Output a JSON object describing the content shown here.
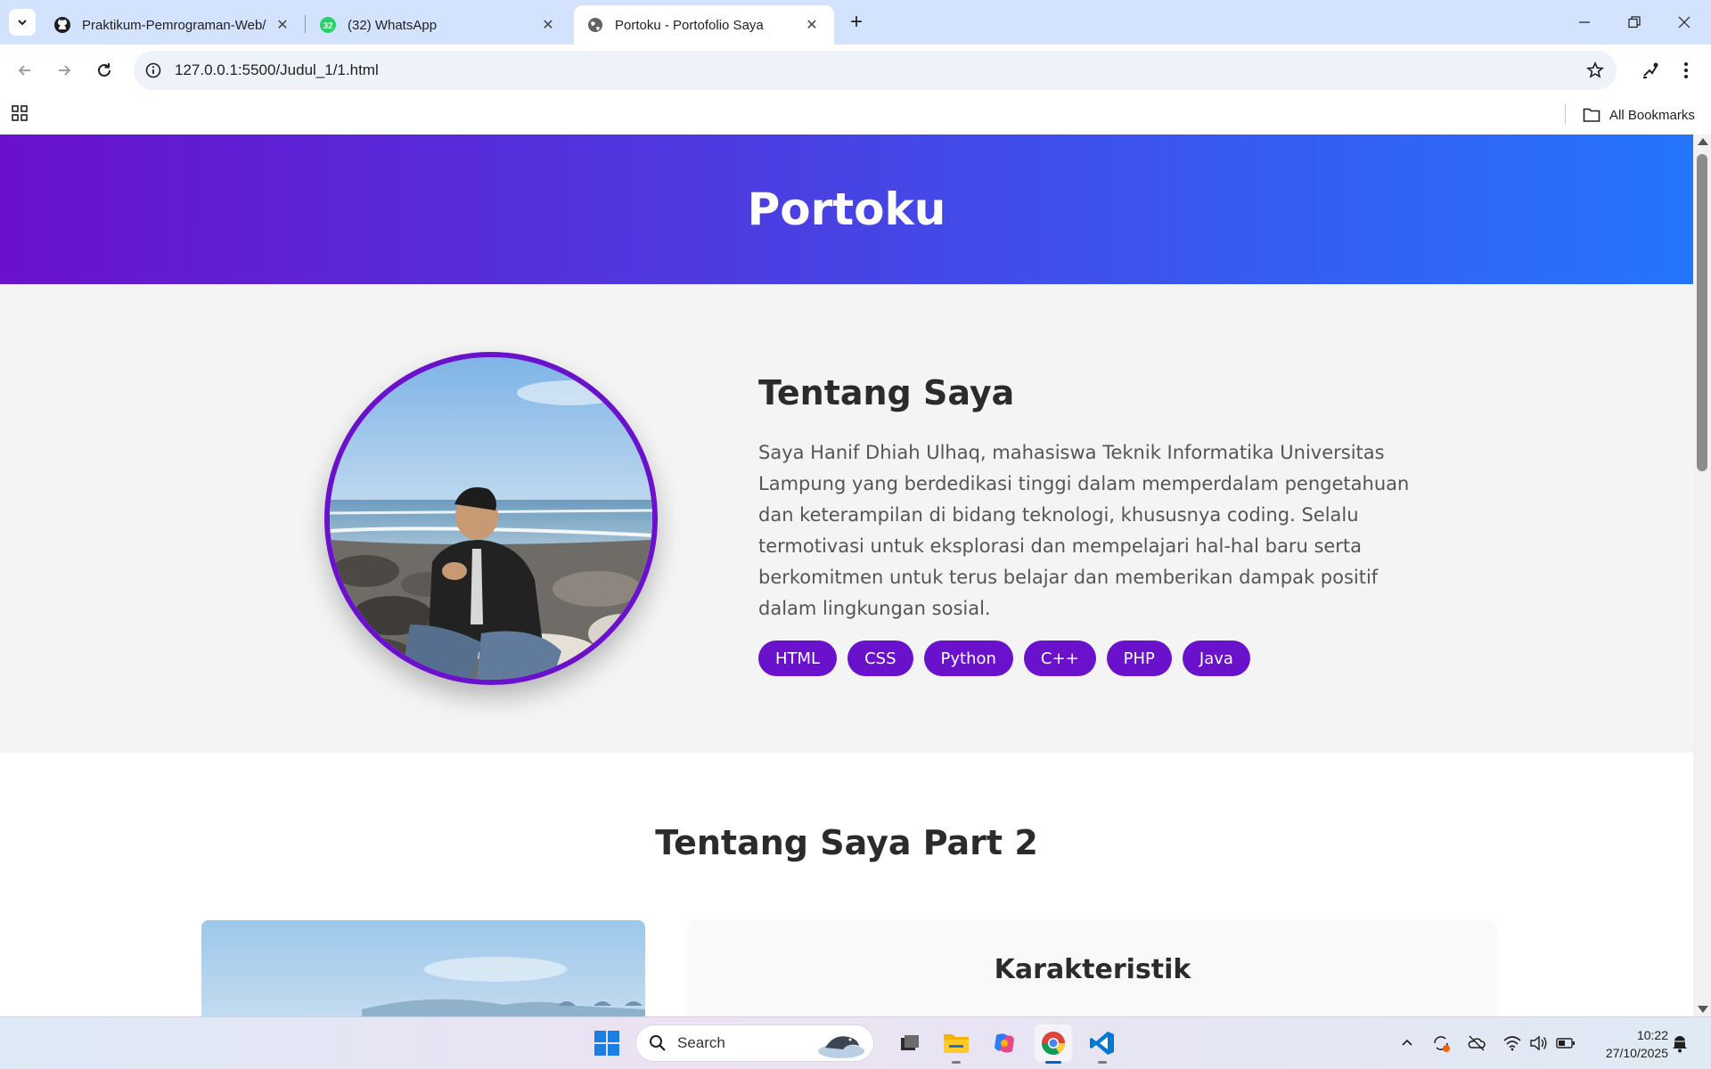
{
  "browser": {
    "tabs": [
      {
        "title": "Praktikum-Pemrograman-Web/",
        "favicon": "github-icon",
        "active": false
      },
      {
        "title": "(32) WhatsApp",
        "favicon": "whatsapp-icon",
        "badge": "32",
        "active": false
      },
      {
        "title": "Portoku - Portofolio Saya",
        "favicon": "globe-icon",
        "active": true
      }
    ],
    "url": "127.0.0.1:5500/Judul_1/1.html",
    "bookmarks_label": "All Bookmarks"
  },
  "page": {
    "header_title": "Portoku",
    "about": {
      "heading": "Tentang Saya",
      "paragraph": "Saya Hanif Dhiah Ulhaq, mahasiswa Teknik Informatika Universitas Lampung yang berdedikasi tinggi dalam memperdalam pengetahuan dan keterampilan di bidang teknologi, khususnya coding. Selalu termotivasi untuk eksplorasi dan mempelajari hal-hal baru serta berkomitmen untuk terus belajar dan memberikan dampak positif dalam lingkungan sosial.",
      "skills": [
        "HTML",
        "CSS",
        "Python",
        "C++",
        "PHP",
        "Java"
      ]
    },
    "part2": {
      "heading": "Tentang Saya Part 2",
      "card_heading": "Karakteristik"
    }
  },
  "taskbar": {
    "search_label": "Search",
    "time": "10:22",
    "date": "27/10/2025"
  },
  "colors": {
    "accent": "#6a11cb",
    "header_gradient_start": "#6a11cb",
    "header_gradient_end": "#2575fc"
  }
}
